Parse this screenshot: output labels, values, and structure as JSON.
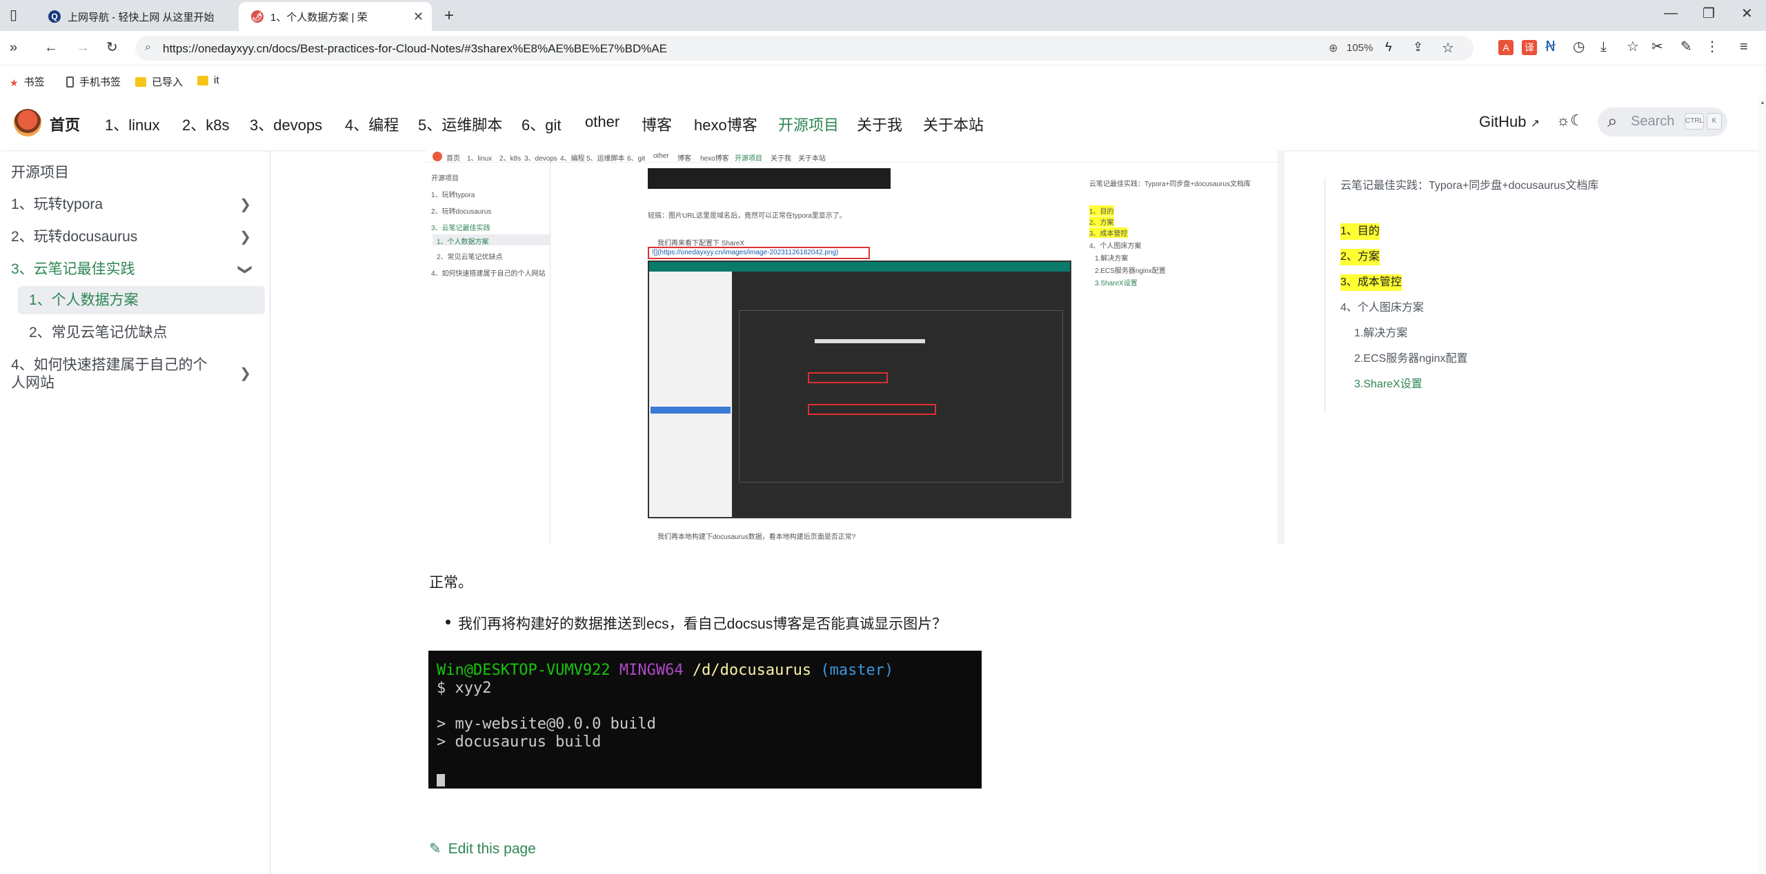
{
  "browser": {
    "tabs": [
      {
        "title": "上网导航 - 轻快上网 从这里开始",
        "favicon": "Q"
      },
      {
        "title": "1、个人数据方案 | 荣",
        "favicon": "🌶"
      }
    ],
    "url": "https://onedayxyy.cn/docs/Best-practices-for-Cloud-Notes/#3sharex%E8%AE%BE%E7%BD%AE",
    "zoom": "105%",
    "bookmarks": [
      {
        "label": "书签",
        "icon": "star-icon"
      },
      {
        "label": "手机书签",
        "icon": "phone-icon"
      },
      {
        "label": "已导入",
        "icon": "folder-icon"
      },
      {
        "label": "it",
        "icon": "folder-icon"
      }
    ]
  },
  "navbar": {
    "home": "首页",
    "links": [
      "1、linux",
      "2、k8s",
      "3、devops",
      "4、编程",
      "5、运维脚本",
      "6、git",
      "other",
      "博客",
      "hexo博客",
      "开源项目",
      "关于我",
      "关于本站"
    ],
    "active": "开源项目",
    "github": "GitHub",
    "search_placeholder": "Search",
    "kbd1": "CTRL",
    "kbd2": "K"
  },
  "sidebar": {
    "category": "开源项目",
    "items": [
      {
        "label": "1、玩转typora",
        "chevron": ">"
      },
      {
        "label": "2、玩转docusaurus",
        "chevron": ">"
      },
      {
        "label": "3、云笔记最佳实践",
        "chevron": "v"
      },
      {
        "label": "1、个人数据方案"
      },
      {
        "label": "2、常见云笔记优缺点"
      },
      {
        "label": "4、如何快速搭建属于自己的个人网站",
        "chevron": ">"
      }
    ]
  },
  "content": {
    "para": "正常。",
    "bullet": "我们再将构建好的数据推送到ecs，看自己docsus博客是否能真诚显示图片？",
    "terminal": {
      "user": "Win@DESKTOP-VUMV922",
      "shell": "MINGW64",
      "path": "/d/docusaurus",
      "branch": "(master)",
      "cmd": "$ xyy2",
      "out1": "> my-website@0.0.0 build",
      "out2": "> docusaurus build"
    },
    "edit": "Edit this page",
    "embedded": {
      "nav": [
        "首页",
        "1、linux",
        "2、k8s",
        "3、devops",
        "4、编程",
        "5、运维脚本",
        "6、git",
        "other",
        "博客",
        "hexo博客",
        "开源项目",
        "关于我",
        "关于本站"
      ],
      "sidebar": [
        "开源项目",
        "1、玩转typora",
        "2、玩转docusaurus",
        "3、云笔记最佳实践",
        "1、个人数据方案",
        "2、常见云笔记优缺点",
        "4、如何快速搭建属于自己的个人网站"
      ],
      "caption": "轻搞：图片URL这里是域名后，竟然可以正常在typora里显示了。",
      "bullet1": "我们再来看下配置下 ShareX",
      "md": "![](https://onedayxyy.cn/images/image-20231126182042.png)",
      "bottom": "我们再本地构建下docusaurus数据，看本地构建后页面是否正常?",
      "toc": [
        "云笔记最佳实践：Typora+同步盘+docusaurus文档库",
        "1、目的",
        "2、方案",
        "3、成本管控",
        "4、个人图床方案",
        "1.解决方案",
        "2.ECS服务器nginx配置",
        "3.ShareX设置"
      ]
    }
  },
  "toc": [
    {
      "label": "云笔记最佳实践：Typora+同步盘+docusaurus文档库"
    },
    {
      "label": "1、目的",
      "hl": true
    },
    {
      "label": "2、方案",
      "hl": true
    },
    {
      "label": "3、成本管控",
      "hl": true
    },
    {
      "label": "4、个人图床方案"
    },
    {
      "label": "1.解决方案"
    },
    {
      "label": "2.ECS服务器nginx配置"
    },
    {
      "label": "3.ShareX设置",
      "active": true
    }
  ],
  "colors": {
    "accent": "#2e8555",
    "highlight": "#ffff33"
  }
}
